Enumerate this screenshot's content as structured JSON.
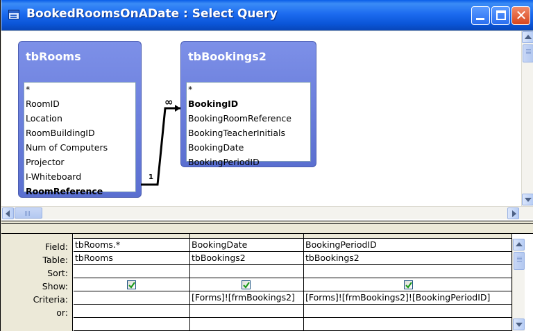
{
  "window": {
    "title": "BookedRoomsOnADate : Select Query"
  },
  "tables": [
    {
      "name": "tbRooms",
      "fields": [
        {
          "label": "*",
          "bold": false
        },
        {
          "label": "RoomID",
          "bold": false
        },
        {
          "label": "Location",
          "bold": false
        },
        {
          "label": "RoomBuildingID",
          "bold": false
        },
        {
          "label": "Num of Computers",
          "bold": false
        },
        {
          "label": "Projector",
          "bold": false
        },
        {
          "label": "I-Whiteboard",
          "bold": false
        },
        {
          "label": "RoomReference",
          "bold": true
        }
      ]
    },
    {
      "name": "tbBookings2",
      "fields": [
        {
          "label": "*",
          "bold": false
        },
        {
          "label": "BookingID",
          "bold": true
        },
        {
          "label": "BookingRoomReference",
          "bold": false
        },
        {
          "label": "BookingTeacherInitials",
          "bold": false
        },
        {
          "label": "BookingDate",
          "bold": false
        },
        {
          "label": "BookingPeriodID",
          "bold": false
        }
      ]
    }
  ],
  "relationship": {
    "one_side_label": "1",
    "many_side_label": "∞"
  },
  "grid": {
    "row_labels": [
      "Field:",
      "Table:",
      "Sort:",
      "Show:",
      "Criteria:",
      "or:"
    ],
    "columns": [
      {
        "field": "tbRooms.*",
        "table": "tbRooms",
        "sort": "",
        "show": true,
        "criteria": "",
        "or": ""
      },
      {
        "field": "BookingDate",
        "table": "tbBookings2",
        "sort": "",
        "show": true,
        "criteria": "[Forms]![frmBookings2]",
        "or": ""
      },
      {
        "field": "BookingPeriodID",
        "table": "tbBookings2",
        "sort": "",
        "show": true,
        "criteria": "[Forms]![frmBookings2]![BookingPeriodID]",
        "or": ""
      }
    ]
  },
  "icons": {
    "window": "query-window-icon",
    "minimize": "minimize-icon",
    "maximize": "maximize-icon",
    "close": "close-icon",
    "check": "checkmark-icon"
  },
  "colors": {
    "titlebar": "#0a5ee8",
    "table_header": "#6b7fd6",
    "check": "#1d9a1d"
  }
}
